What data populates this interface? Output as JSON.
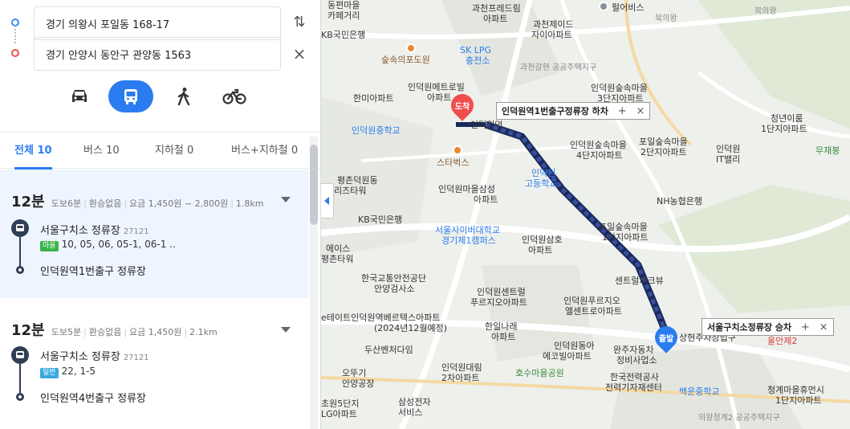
{
  "search": {
    "origin": "경기 의왕시 포일동 168-17",
    "destination": "경기 안양시 동안구 관양동 1563",
    "swap_icon": "swap-vertical-icon",
    "clear_icon": "close-icon"
  },
  "modes": [
    {
      "name": "car",
      "icon": "car-icon",
      "active": false
    },
    {
      "name": "transit",
      "icon": "bus-icon",
      "active": true
    },
    {
      "name": "walk",
      "icon": "walk-icon",
      "active": false
    },
    {
      "name": "bike",
      "icon": "bike-icon",
      "active": false
    }
  ],
  "tabs": [
    {
      "label": "전체",
      "count": "10",
      "active": true
    },
    {
      "label": "버스",
      "count": "10",
      "active": false
    },
    {
      "label": "지하철",
      "count": "0",
      "active": false
    },
    {
      "label": "버스+지하철",
      "count": "0",
      "active": false
    }
  ],
  "results": [
    {
      "time": "12분",
      "walk": "도보6분",
      "transfer": "환승없음",
      "fare": "요금 1,450원 ~ 2,800원",
      "distance": "1.8km",
      "board_stop": "서울구치소 정류장",
      "board_id": "27121",
      "bus_type": "마을",
      "bus_lines": "10, 05, 06, 05-1, 06-1 ..",
      "alight_stop": "인덕원역1번출구 정류장"
    },
    {
      "time": "12분",
      "walk": "도보5분",
      "transfer": "환승없음",
      "fare": "요금 1,450원",
      "distance": "2.1km",
      "board_stop": "서울구치소 정류장",
      "board_id": "27121",
      "bus_type": "일반",
      "bus_lines": "22, 1-5",
      "alight_stop": "인덕원역4번출구 정류장"
    }
  ],
  "map": {
    "dest_pin": "도착",
    "origin_pin": "출발",
    "callout_dest": "인덕원역1번출구정류장 하차",
    "callout_origin": "서울구치소정류장 승차",
    "callout_plus": "+",
    "callout_close": "×",
    "labels": {
      "l1": "동편마을",
      "l1b": "카페거리",
      "l2": "과천프레드림",
      "l2b": "아파트",
      "l3": "펄어비스",
      "l4": "북의왕",
      "l4b": "북의왕",
      "l5": "KB국민은행",
      "l6": "과천제이드",
      "l6b": "자이아파트",
      "l7": "SK LPG",
      "l7b": "충전소",
      "l8": "숲속의포도원",
      "l9": "과천갈현 공공주택지구",
      "l10": "인덕원메트로빌",
      "l10b": "아파트",
      "l11": "한미아파트",
      "l12": "인덕원숲속마을",
      "l12b": "3단지아파트",
      "l13": "인덕원중학교",
      "l14": "청년이룸",
      "l14b": "1단지아파트",
      "l15": "무재봉",
      "l16": "인덕원숲속마을",
      "l16b": "4단지아파트",
      "l17": "포일숲속마을",
      "l17b": "2단지아파트",
      "l18": "인덕원",
      "l18b": "IT밸리",
      "l19": "스타벅스",
      "l20": "인덕원",
      "l20b": "고등학교",
      "l21": "평촌덕원동",
      "l21b": "리즈타워",
      "l22": "인덕원마을삼성",
      "l22b": "아파트",
      "l23": "NH농협은행",
      "l24": "KB국민은행",
      "l25": "서울사이버대학교",
      "l25b": "경기제1캠퍼스",
      "l26": "포일숲속마을",
      "l26b": "1단지아파트",
      "l27": "에이스",
      "l27b": "평촌타워",
      "l28": "인덕원삼호",
      "l28b": "아파트",
      "l29": "한국교통안전공단",
      "l29b": "안양검사소",
      "l30": "인덕원센트럴",
      "l30b": "푸르지오아파트",
      "l31": "센트럴파크뷰",
      "l32": "인덕원푸르지오",
      "l32b": "엘센트로아파트",
      "l33": "e테이트인덕원역베르텍스아파트",
      "l33b": "(2024년12월예정)",
      "l34": "한일나래",
      "l34b": "아파트",
      "l35": "두산벤처다임",
      "l36": "인덕원동아",
      "l36b": "에코빌아파트",
      "l37": "완주자동차",
      "l37b": "정비사업소",
      "l38": "상현주차장입구",
      "l39": "오뚜기",
      "l39b": "안양공장",
      "l40": "인덕원대림",
      "l40b": "2차아파트",
      "l41": "호수마을공원",
      "l42": "한국전력공사",
      "l42b": "전력기자재센터",
      "l43": "백운중학교",
      "l44": "청계마을휴먼시",
      "l44b": "1단지아파트",
      "l45": "초원5단지",
      "l45b": "LG아파트",
      "l46": "삼성전자",
      "l46b": "서비스",
      "l47": "의왕청계2 공공주택지구",
      "l48": "울안제2",
      "l49": "인덕원역"
    }
  }
}
